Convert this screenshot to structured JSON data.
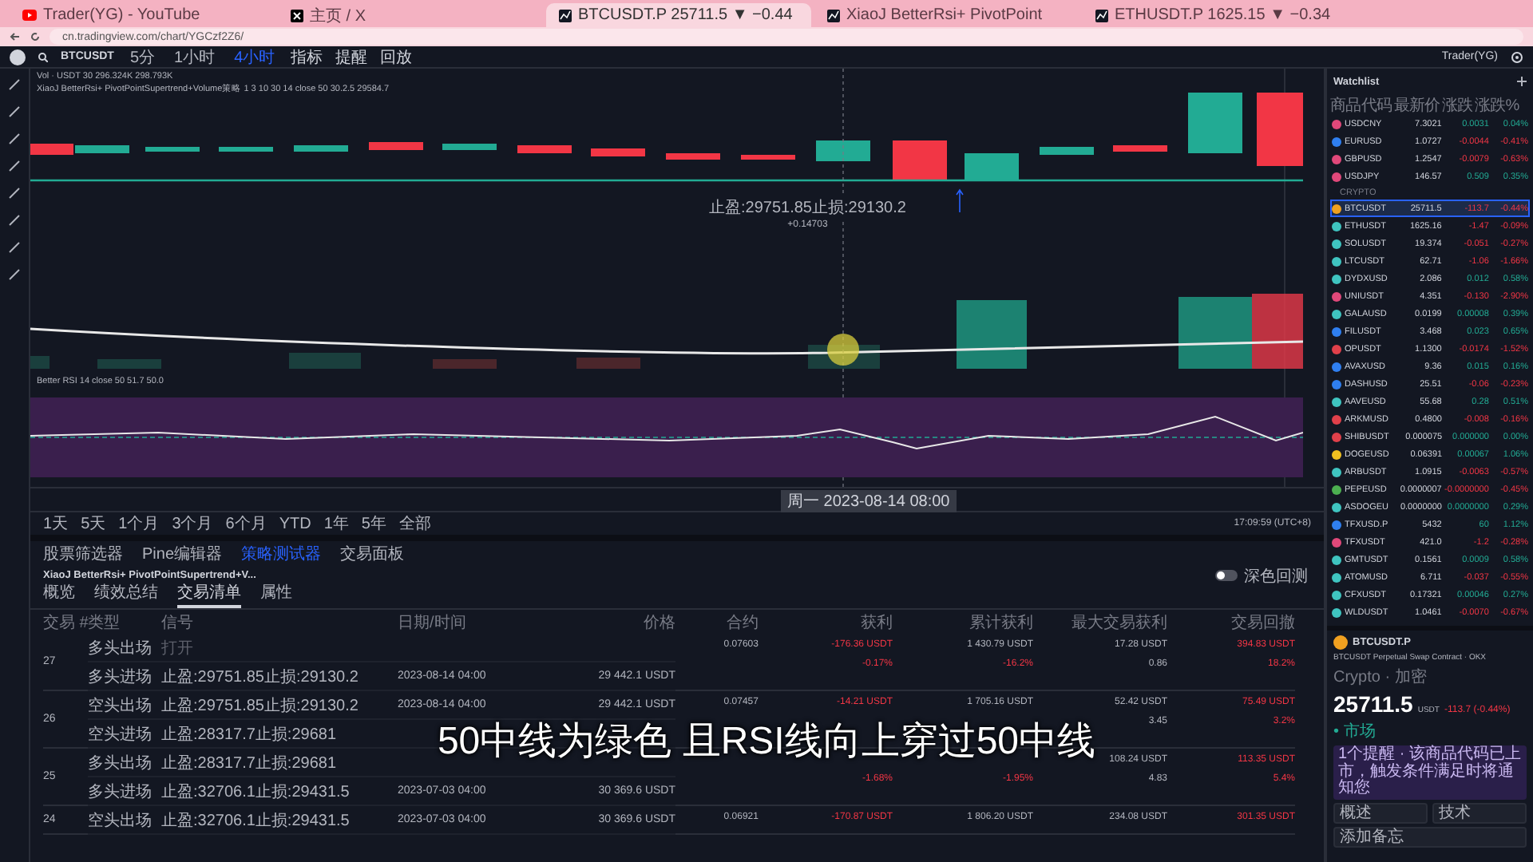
{
  "browser": {
    "tabs": [
      {
        "title": "Trader(YG) - YouTube",
        "selected": false
      },
      {
        "title": "主页 / X",
        "selected": false
      },
      {
        "title": "BTCUSDT.P 25711.5 ▼ −0.44",
        "selected": true
      },
      {
        "title": "XiaoJ BetterRsi+ PivotPoint",
        "selected": false
      },
      {
        "title": "ETHUSDT.P 1625.15 ▼ −0.34",
        "selected": false
      }
    ],
    "url": "cn.tradingview.com/chart/YGCzf2Z6/"
  },
  "toolbar": {
    "symbol": "BTCUSDT",
    "intervals": [
      {
        "label": "5分",
        "selected": false
      },
      {
        "label": "1小时",
        "selected": false
      },
      {
        "label": "4小时",
        "selected": true
      }
    ],
    "buttons": [
      "指标",
      "提醒",
      "回放"
    ],
    "account": "Trader(YG)"
  },
  "chart": {
    "legend": [
      "Vol · USDT 30 296.324K 298.793K",
      "XiaoJ BetterRsi+ PivotPointSupertrend+Volume策略 1 3 10 30 14 close 50 30.2.5 29584.7"
    ],
    "rsi_legend": "Better RSI 14 close 50 51.7 50.0",
    "annotation": [
      "止盈:29751.85止损:29130.2",
      "+0.14703"
    ],
    "crosshair_time": "周一 2023-08-14 08:00",
    "ranges": [
      "1天",
      "5天",
      "1个月",
      "3个月",
      "6个月",
      "YTD",
      "1年",
      "5年",
      "全部"
    ],
    "clock": "17:09:59 (UTC+8)"
  },
  "panel": {
    "tabs": [
      {
        "label": "股票筛选器",
        "selected": false
      },
      {
        "label": "Pine编辑器",
        "selected": false
      },
      {
        "label": "策略测试器",
        "selected": true
      },
      {
        "label": "交易面板",
        "selected": false
      }
    ],
    "strategy": "XiaoJ BetterRsi+ PivotPointSupertrend+V...",
    "subtabs": [
      {
        "label": "概览",
        "selected": false
      },
      {
        "label": "绩效总结",
        "selected": false
      },
      {
        "label": "交易清单",
        "selected": true
      },
      {
        "label": "属性",
        "selected": false
      }
    ],
    "toggle": {
      "label": "深色回测",
      "on": false
    },
    "columns": [
      "交易 #",
      "类型",
      "信号",
      "日期/时间",
      "价格",
      "合约",
      "获利",
      "累计获利",
      "最大交易获利",
      "交易回撤"
    ],
    "trades": [
      {
        "number": "27",
        "contracts": "0.07603",
        "profit": {
          "value": "-176.36 USDT",
          "percent": "-0.17%"
        },
        "cumulative": {
          "value": "1 430.79 USDT",
          "percent": "-16.2%"
        },
        "run_up": [
          "17.28 USDT",
          "0.86"
        ],
        "drawdown": [
          "394.83 USDT",
          "18.2%"
        ],
        "legs": [
          {
            "type": "多头出场",
            "signal": "打开",
            "pending": true
          },
          {
            "type": "多头进场",
            "signal": "止盈:29751.85止损:29130.2",
            "pending": false,
            "date": "2023-08-14 04:00",
            "price": "29 442.1 USDT"
          }
        ]
      },
      {
        "number": "26",
        "contracts": "0.07457",
        "profit": {
          "value": "-14.21 USDT"
        },
        "cumulative": {
          "value": "1 705.16 USDT"
        },
        "run_up": [
          "52.42 USDT",
          "3.45"
        ],
        "drawdown": [
          "75.49 USDT",
          "3.2%"
        ],
        "legs": [
          {
            "type": "空头出场",
            "signal": "止盈:29751.85止损:29130.2",
            "pending": false,
            "date": "2023-08-14 04:00",
            "price": "29 442.1 USDT"
          },
          {
            "type": "空头进场",
            "signal": "止盈:28317.7止损:29681",
            "pending": false
          }
        ]
      },
      {
        "number": "25",
        "profit": {
          "percent": "-1.68%"
        },
        "cumulative": {
          "percent": "-1.95%"
        },
        "run_up": [
          "108.24 USDT",
          "4.83"
        ],
        "drawdown": [
          "113.35 USDT",
          "5.4%"
        ],
        "legs": [
          {
            "type": "多头出场",
            "signal": "止盈:28317.7止损:29681",
            "pending": false
          },
          {
            "type": "多头进场",
            "signal": "止盈:32706.1止损:29431.5",
            "pending": false,
            "date": "2023-07-03 04:00",
            "price": "30 369.6 USDT"
          }
        ]
      },
      {
        "number": "24",
        "contracts": "0.06921",
        "profit": {
          "value": "-170.87 USDT"
        },
        "cumulative": {
          "value": "1 806.20 USDT"
        },
        "run_up": [
          "234.08 USDT"
        ],
        "drawdown": [
          "301.35 USDT"
        ],
        "legs": [
          {
            "type": "空头出场",
            "signal": "止盈:32706.1止损:29431.5",
            "pending": false,
            "date": "2023-07-03 04:00",
            "price": "30 369.6 USDT"
          }
        ]
      }
    ]
  },
  "watchlist": {
    "title": "Watchlist",
    "columns": [
      "商品代码",
      "最新价",
      "涨跌",
      "涨跌%"
    ],
    "items": [
      {
        "kind": "row",
        "symbol": "USDCNY",
        "last": "7.3021",
        "change": "0.0031",
        "percent": "0.04%",
        "color": "#e0487a",
        "selected": false,
        "up": true
      },
      {
        "kind": "row",
        "symbol": "EURUSD",
        "last": "1.0727",
        "change": "-0.0044",
        "percent": "-0.41%",
        "color": "#2f7ff0",
        "selected": false,
        "up": false
      },
      {
        "kind": "row",
        "symbol": "GBPUSD",
        "last": "1.2547",
        "change": "-0.0079",
        "percent": "-0.63%",
        "color": "#e0487a",
        "selected": false,
        "up": false
      },
      {
        "kind": "row",
        "symbol": "USDJPY",
        "last": "146.57",
        "change": "0.509",
        "percent": "0.35%",
        "color": "#e0487a",
        "selected": false,
        "up": true
      },
      {
        "kind": "section",
        "symbol": "CRYPTO"
      },
      {
        "kind": "row",
        "symbol": "BTCUSDT",
        "last": "25711.5",
        "change": "-113.7",
        "percent": "-0.44%",
        "color": "#f0a020",
        "selected": true,
        "up": false
      },
      {
        "kind": "row",
        "symbol": "ETHUSDT",
        "last": "1625.16",
        "change": "-1.47",
        "percent": "-0.09%",
        "color": "#3fc4c0",
        "selected": false,
        "up": false
      },
      {
        "kind": "row",
        "symbol": "SOLUSDT",
        "last": "19.374",
        "change": "-0.051",
        "percent": "-0.27%",
        "color": "#3fc4c0",
        "selected": false,
        "up": false
      },
      {
        "kind": "row",
        "symbol": "LTCUSDT",
        "last": "62.71",
        "change": "-1.06",
        "percent": "-1.66%",
        "color": "#3fc4c0",
        "selected": false,
        "up": false
      },
      {
        "kind": "row",
        "symbol": "DYDXUSD",
        "last": "2.086",
        "change": "0.012",
        "percent": "0.58%",
        "color": "#3fc4c0",
        "selected": false,
        "up": true
      },
      {
        "kind": "row",
        "symbol": "UNIUSDT",
        "last": "4.351",
        "change": "-0.130",
        "percent": "-2.90%",
        "color": "#e0487a",
        "selected": false,
        "up": false
      },
      {
        "kind": "row",
        "symbol": "GALAUSD",
        "last": "0.0199",
        "change": "0.00008",
        "percent": "0.39%",
        "color": "#3fc4c0",
        "selected": false,
        "up": true
      },
      {
        "kind": "row",
        "symbol": "FILUSDT",
        "last": "3.468",
        "change": "0.023",
        "percent": "0.65%",
        "color": "#2f7ff0",
        "selected": false,
        "up": true
      },
      {
        "kind": "row",
        "symbol": "OPUSDT",
        "last": "1.1300",
        "change": "-0.0174",
        "percent": "-1.52%",
        "color": "#e0404a",
        "selected": false,
        "up": false
      },
      {
        "kind": "row",
        "symbol": "AVAXUSD",
        "last": "9.36",
        "change": "0.015",
        "percent": "0.16%",
        "color": "#2f7ff0",
        "selected": false,
        "up": true
      },
      {
        "kind": "row",
        "symbol": "DASHUSD",
        "last": "25.51",
        "change": "-0.06",
        "percent": "-0.23%",
        "color": "#2f7ff0",
        "selected": false,
        "up": false
      },
      {
        "kind": "row",
        "symbol": "AAVEUSD",
        "last": "55.68",
        "change": "0.28",
        "percent": "0.51%",
        "color": "#3fc4c0",
        "selected": false,
        "up": true
      },
      {
        "kind": "row",
        "symbol": "ARKMUSD",
        "last": "0.4800",
        "change": "-0.008",
        "percent": "-0.16%",
        "color": "#e0404a",
        "selected": false,
        "up": false
      },
      {
        "kind": "row",
        "symbol": "SHIBUSDT",
        "last": "0.000075",
        "change": "0.000000",
        "percent": "0.00%",
        "color": "#e0404a",
        "selected": false,
        "up": true
      },
      {
        "kind": "row",
        "symbol": "DOGEUSD",
        "last": "0.06391",
        "change": "0.00067",
        "percent": "1.06%",
        "color": "#f0c020",
        "selected": false,
        "up": true
      },
      {
        "kind": "row",
        "symbol": "ARBUSDT",
        "last": "1.0915",
        "change": "-0.0063",
        "percent": "-0.57%",
        "color": "#3fc4c0",
        "selected": false,
        "up": false
      },
      {
        "kind": "row",
        "symbol": "PEPEUSD",
        "last": "0.0000007",
        "change": "-0.0000000",
        "percent": "-0.45%",
        "color": "#4caf50",
        "selected": false,
        "up": false
      },
      {
        "kind": "row",
        "symbol": "ASDOGEU",
        "last": "0.0000000",
        "change": "0.0000000",
        "percent": "0.29%",
        "color": "#3fc4c0",
        "selected": false,
        "up": true
      },
      {
        "kind": "row",
        "symbol": "TFXUSD.P",
        "last": "5432",
        "change": "60",
        "percent": "1.12%",
        "color": "#2f7ff0",
        "selected": false,
        "up": true
      },
      {
        "kind": "row",
        "symbol": "TFXUSDT",
        "last": "421.0",
        "change": "-1.2",
        "percent": "-0.28%",
        "color": "#e0487a",
        "selected": false,
        "up": false
      },
      {
        "kind": "row",
        "symbol": "GMTUSDT",
        "last": "0.1561",
        "change": "0.0009",
        "percent": "0.58%",
        "color": "#3fc4c0",
        "selected": false,
        "up": true
      },
      {
        "kind": "row",
        "symbol": "ATOMUSD",
        "last": "6.711",
        "change": "-0.037",
        "percent": "-0.55%",
        "color": "#3fc4c0",
        "selected": false,
        "up": false
      },
      {
        "kind": "row",
        "symbol": "CFXUSDT",
        "last": "0.17321",
        "change": "0.00046",
        "percent": "0.27%",
        "color": "#3fc4c0",
        "selected": false,
        "up": true
      },
      {
        "kind": "row",
        "symbol": "WLDUSDT",
        "last": "1.0461",
        "change": "-0.0070",
        "percent": "-0.67%",
        "color": "#3fc4c0",
        "selected": false,
        "up": false
      }
    ]
  },
  "details": {
    "symbol": "BTCUSDT.P",
    "description": "BTCUSDT Perpetual Swap Contract · OKX",
    "category": "Crypto · 加密",
    "price": "25711.5",
    "currency": "USDT",
    "change": "-113.7 (-0.44%)",
    "status": "• 市场",
    "notice": "1个提醒 · 该商品代码已上市，触发条件满足时将通知您",
    "buttons": [
      "概述",
      "技术"
    ],
    "note": "添加备忘"
  },
  "subtitle": "50中线为绿色 且RSI线向上穿过50中线"
}
